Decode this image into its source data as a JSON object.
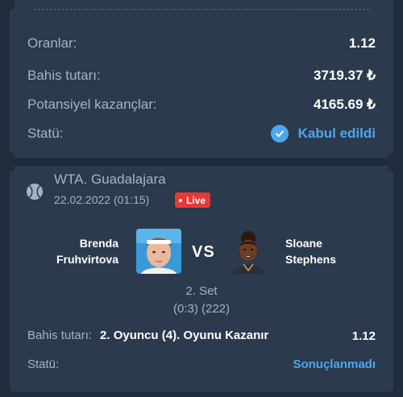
{
  "summary": {
    "odds_label": "Oranlar:",
    "odds_value": "1.12",
    "stake_label": "Bahis tutarı:",
    "stake_value": "3719.37 ₺",
    "potential_label": "Potansiyel kazançlar:",
    "potential_value": "4165.69 ₺",
    "status_label": "Statü:",
    "status_value": "Kabul edildi"
  },
  "event": {
    "tournament": "WTA. Guadalajara",
    "date": "22.02.2022 (01:15)",
    "live_label": "Live",
    "player1_line1": "Brenda",
    "player1_line2": "Fruhvirtova",
    "vs_label": "VS",
    "player2_line1": "Sloane",
    "player2_line2": "Stephens",
    "set_text": "2. Set",
    "score_text": "(0:3) (222)"
  },
  "bet": {
    "stake_label": "Bahis tutarı:",
    "market": "2. Oyuncu (4). Oyunu Kazanır",
    "odds": "1.12",
    "status_label": "Statü:",
    "status_value": "Sonuçlanmadı"
  },
  "icons": {
    "status": "check-circle-icon",
    "sport": "tennis-ball-icon"
  },
  "colors": {
    "background": "#1f2c3c",
    "card": "#2b3a4d",
    "accent": "#4da7ef",
    "live": "#e53935"
  }
}
